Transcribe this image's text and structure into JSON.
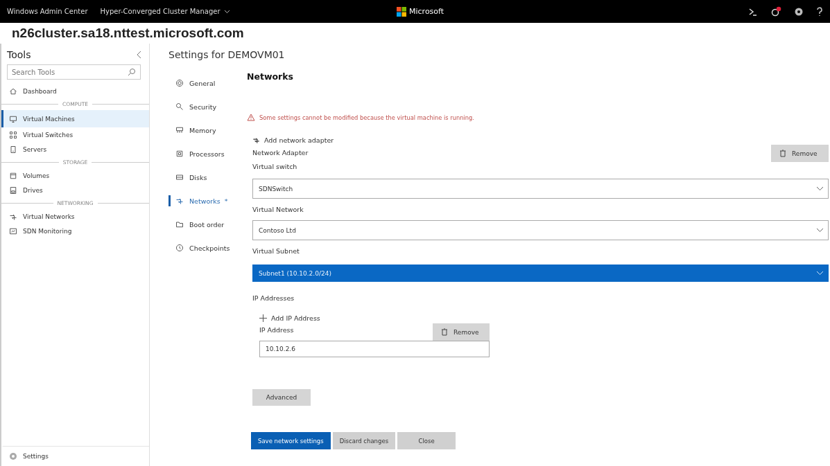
{
  "top_bar": {
    "product": "Windows Admin Center",
    "app_menu": "Hyper-Converged Cluster Manager",
    "brand": "Microsoft",
    "notification_badge": true
  },
  "connection": "n26cluster.sa18.nttest.microsoft.com",
  "tools": {
    "title": "Tools",
    "search": {
      "placeholder": "Search Tools"
    },
    "sections": [
      {
        "items": [
          {
            "label": "Dashboard",
            "selected": false
          }
        ]
      },
      {
        "heading": "COMPUTE",
        "items": [
          {
            "label": "Virtual Machines",
            "selected": true
          },
          {
            "label": "Virtual Switches",
            "selected": false
          },
          {
            "label": "Servers",
            "selected": false
          }
        ]
      },
      {
        "heading": "STORAGE",
        "items": [
          {
            "label": "Volumes",
            "selected": false
          },
          {
            "label": "Drives",
            "selected": false
          }
        ]
      },
      {
        "heading": "NETWORKING",
        "items": [
          {
            "label": "Virtual Networks",
            "selected": false
          },
          {
            "label": "SDN Monitoring",
            "selected": false
          }
        ]
      }
    ],
    "footer": "Settings"
  },
  "settings": {
    "title": "Settings for DEMOVM01",
    "nav": [
      {
        "label": "General",
        "selected": false
      },
      {
        "label": "Security",
        "selected": false
      },
      {
        "label": "Memory",
        "selected": false
      },
      {
        "label": "Processors",
        "selected": false
      },
      {
        "label": "Disks",
        "selected": false
      },
      {
        "label": "Networks",
        "selected": true,
        "marker": "*"
      },
      {
        "label": "Boot order",
        "selected": false
      },
      {
        "label": "Checkpoints",
        "selected": false
      }
    ]
  },
  "networks": {
    "heading": "Networks",
    "warning": "Some settings cannot be modified because the virtual machine is running.",
    "add_adapter": "Add network adapter",
    "adapter_label": "Network Adapter",
    "remove_adapter": "Remove",
    "fields": [
      {
        "label": "Virtual switch",
        "value": "SDNSwitch",
        "selected": false
      },
      {
        "label": "Virtual Network",
        "value": "Contoso Ltd",
        "selected": false
      },
      {
        "label": "Virtual Subnet",
        "value": "Subnet1 (10.10.2.0/24)",
        "selected": true
      }
    ],
    "ip_heading": "IP Addresses",
    "add_ip": "Add IP Address",
    "ip_label": "IP Address",
    "remove_ip": "Remove",
    "ip_value": "10.10.2.6",
    "advanced": "Advanced"
  },
  "actions": [
    {
      "label": "Save network settings",
      "primary": true
    },
    {
      "label": "Discard changes",
      "primary": false
    },
    {
      "label": "Close",
      "primary": false
    }
  ]
}
